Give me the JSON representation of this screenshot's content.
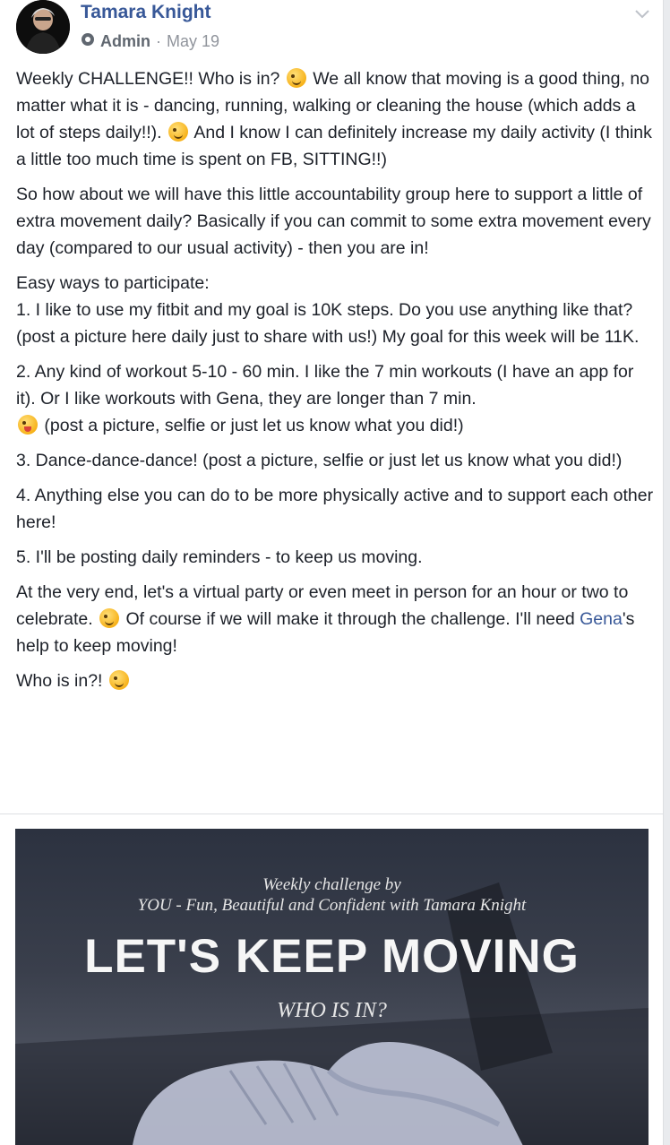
{
  "post": {
    "author": "Tamara Knight",
    "role": "Admin",
    "date": "May 19",
    "paragraphs": {
      "p1a": "Weekly CHALLENGE!! Who is in?",
      "p1b": "We all know that moving is a good thing, no matter what it is - dancing, running, walking or cleaning the house (which adds a lot of steps daily!!).",
      "p1c": "And I know I can definitely increase my daily activity (I think a little too much time is spent on FB, SITTING!!)",
      "p2": "So how about we will have this little accountability group here to support a little of extra movement daily? Basically if you can commit to some extra movement every day (compared to our usual activity) - then you are in!",
      "p3": "Easy ways to participate:",
      "p3b": "1. I like to use my fitbit and my goal is 10K steps. Do you use anything like that? (post a picture here daily just to share with us!) My goal for this week will be 11K.",
      "p4a": "2. Any kind of workout 5-10 - 60 min. I like the 7 min workouts (I have an app for it). Or I like workouts with Gena, they are longer than 7 min.",
      "p4b": "(post a picture, selfie or just let us know what you did!)",
      "p5": "3. Dance-dance-dance! (post a picture, selfie or just let us know what you did!)",
      "p6": "4. Anything else you can do to be more physically active and to support each other here!",
      "p7": "5. I'll be posting daily reminders - to keep us moving.",
      "p8a": "At the very end, let's a virtual party or even meet in person for an hour or two to celebrate.",
      "p8b": "Of course if we will make it through the challenge. I'll need",
      "p8link": "Gena",
      "p8c": "'s help to keep moving!",
      "p9": "Who is in?!"
    },
    "image": {
      "line1": "Weekly challenge by",
      "line2": "YOU - Fun, Beautiful and Confident with Tamara Knight",
      "headline": "LET'S KEEP MOVING",
      "sub": "WHO IS IN?"
    },
    "icons": {
      "wink": "winking-face-emoji",
      "tongue": "tongue-out-emoji",
      "admin_badge": "shield-badge-icon",
      "menu": "chevron-down-icon"
    }
  }
}
